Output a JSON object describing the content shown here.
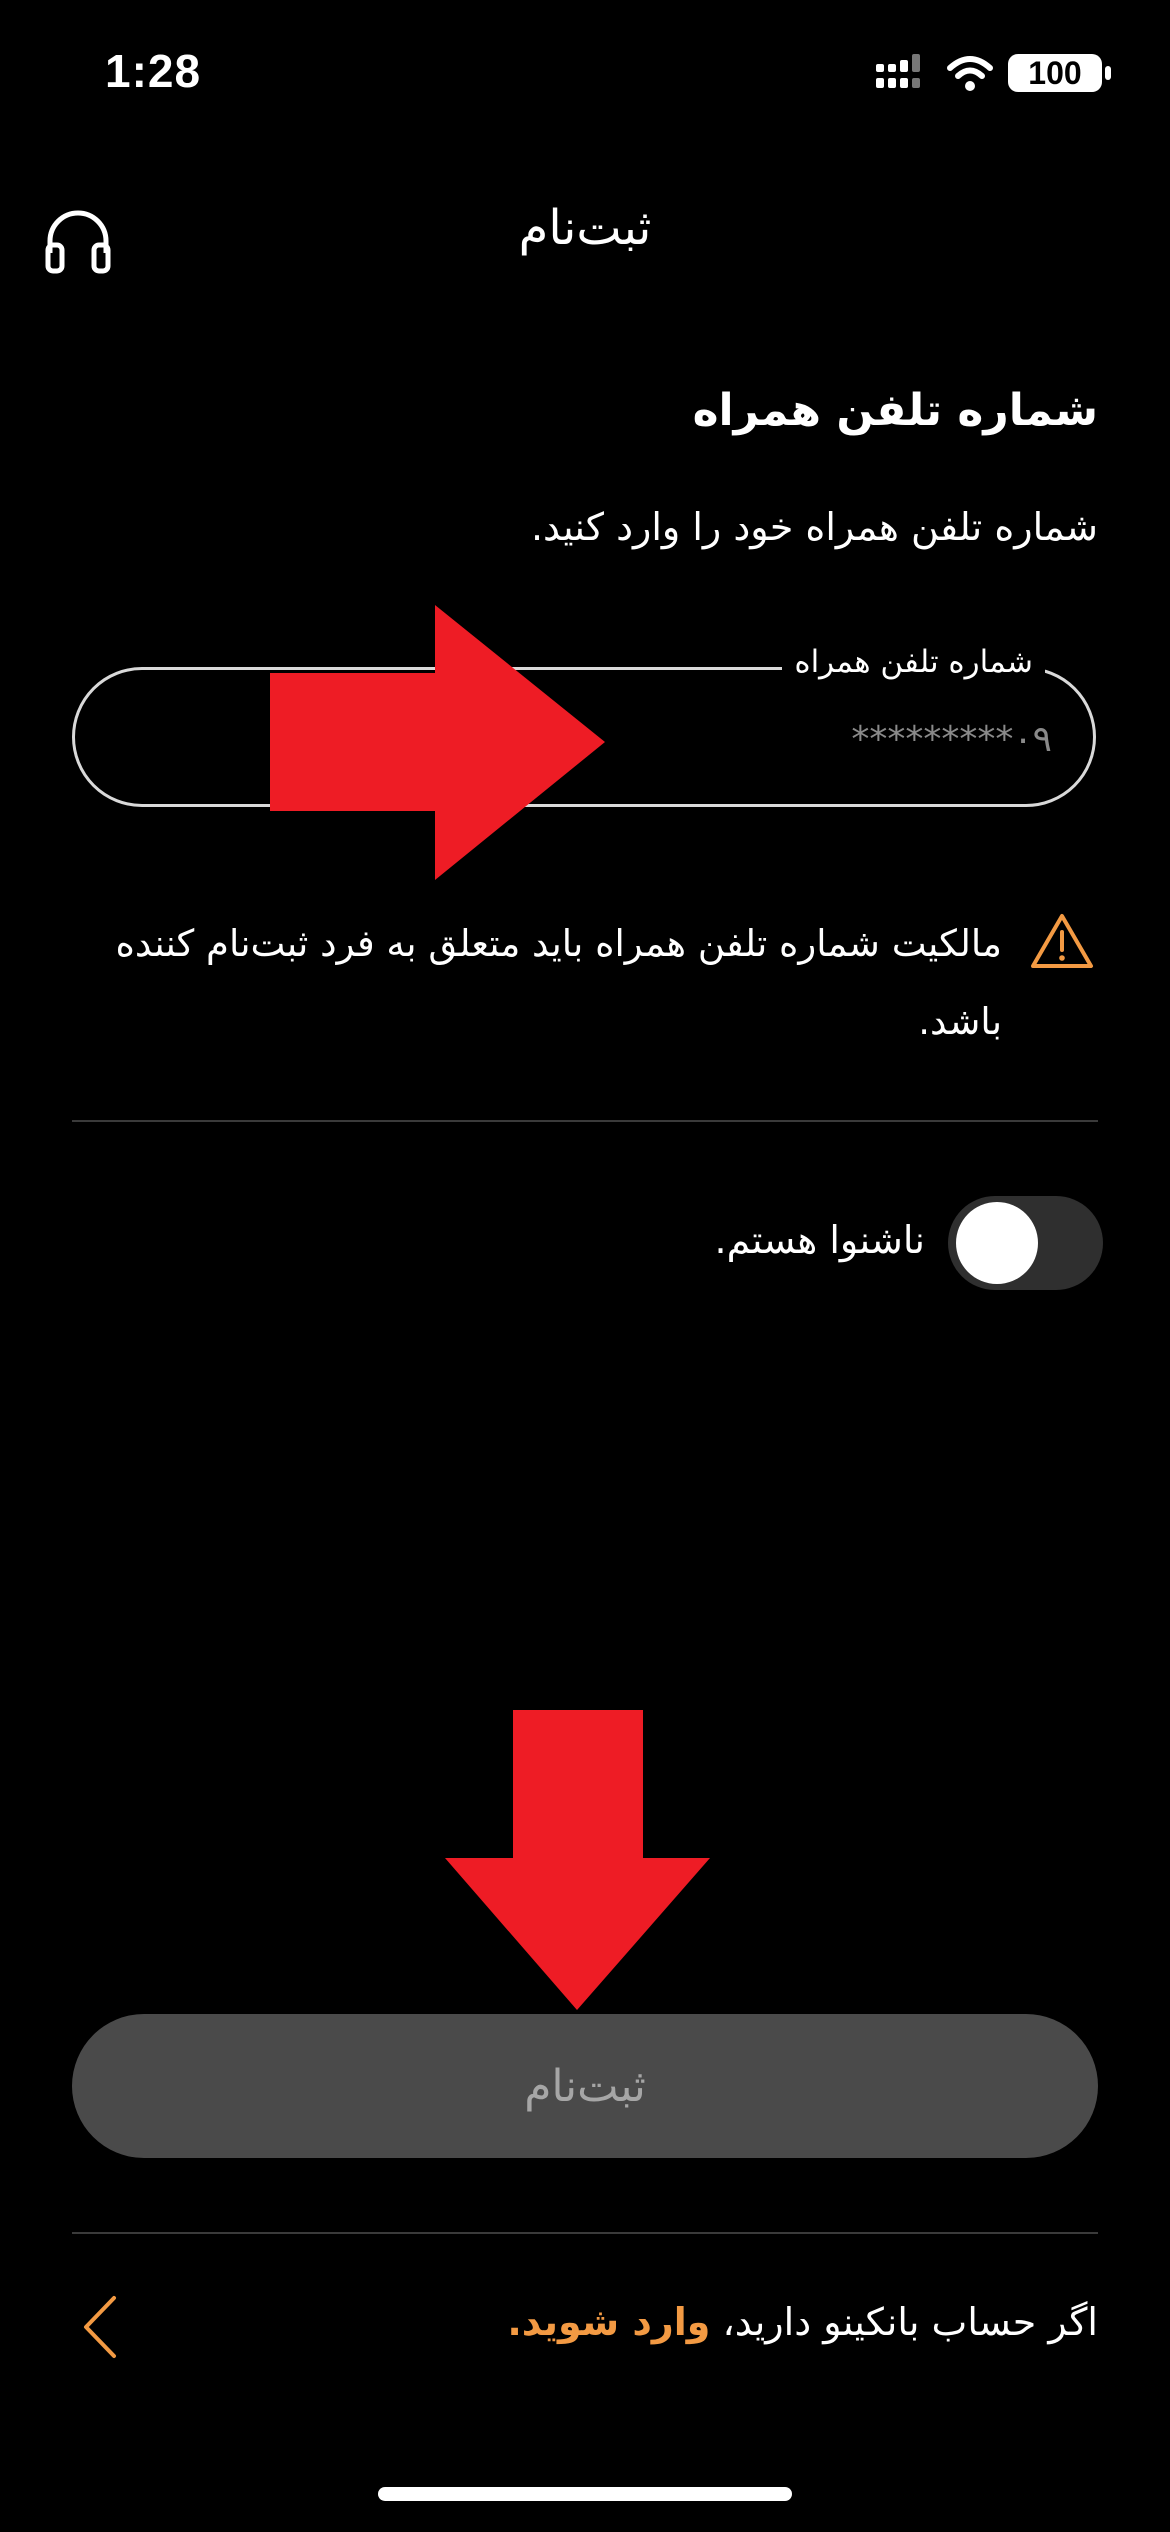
{
  "status_bar": {
    "time": "1:28",
    "battery": "100",
    "icons": [
      "signal-icon",
      "wifi-icon",
      "battery-icon"
    ]
  },
  "header": {
    "title": "ثبت‌نام",
    "support_icon": "headphones-icon"
  },
  "phone_section": {
    "title": "شماره تلفن همراه",
    "description": "شماره تلفن همراه خود را وارد کنید.",
    "input_label": "شماره تلفن همراه",
    "input_placeholder": "۰۹*********",
    "input_value": ""
  },
  "warning": {
    "icon": "warning-icon",
    "text": "مالکیت شماره تلفن همراه باید متعلق به فرد ثبت‌نام کننده باشد.",
    "color": "#f39a43"
  },
  "deaf_toggle": {
    "label": "ناشنوا هستم.",
    "checked": false
  },
  "register_button": {
    "label": "ثبت‌نام",
    "enabled": false
  },
  "login": {
    "prefix": "اگر حساب بانکینو دارید، ",
    "link": "وارد شوید.",
    "link_color": "#f39a43"
  },
  "annotations": {
    "arrow_color": "#ee1c25"
  }
}
